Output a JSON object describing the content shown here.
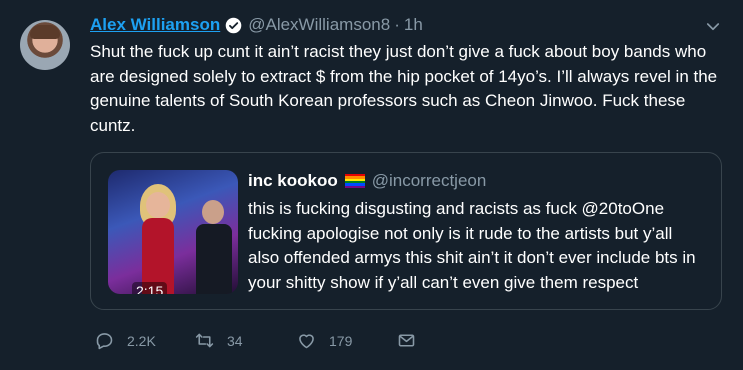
{
  "tweet": {
    "author_name": "Alex Williamson",
    "handle": "@AlexWilliamson8",
    "separator": "·",
    "time": "1h",
    "text": "Shut the fuck up cunt it ain’t racist they just don’t give a fuck about boy bands who are designed solely to extract $ from the hip pocket of 14yo’s. I’ll always revel in the genuine talents of South Korean professors such as Cheon Jinwoo. Fuck these cuntz."
  },
  "quoted": {
    "author_name": "inc kookoo",
    "handle": "@incorrectjeon",
    "video_duration": "2:15",
    "text": "this is fucking disgusting and racists as fuck @20toOne fucking apologise not only is it rude to the artists but y’all also offended armys this shit ain’t it don’t ever include bts in your shitty show if y’all can’t even give them respect"
  },
  "actions": {
    "replies": "2.2K",
    "retweets": "34",
    "likes": "179"
  },
  "icons": {
    "verified": "verified-badge-icon",
    "caret": "chevron-down-icon",
    "reply": "reply-icon",
    "retweet": "retweet-icon",
    "like": "heart-icon",
    "dm": "envelope-icon"
  },
  "colors": {
    "background": "#15202b",
    "accent": "#1da1f2",
    "muted": "#8899a6",
    "border": "#38444d"
  }
}
